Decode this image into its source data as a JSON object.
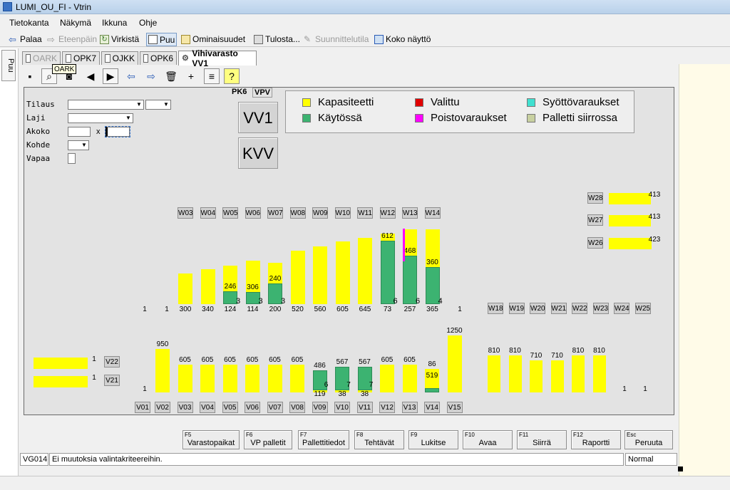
{
  "window": {
    "title": "LUMI_OU_FI - Vtrin"
  },
  "menu": [
    "Tietokanta",
    "Näkymä",
    "Ikkuna",
    "Ohje"
  ],
  "toolbar": {
    "back": "Palaa",
    "forward": "Eteenpäin",
    "refresh": "Virkistä",
    "tree": "Puu",
    "properties": "Ominaisuudet",
    "print": "Tulosta...",
    "design": "Suunnittelutila",
    "fullscreen": "Koko näyttö"
  },
  "side_tab": "Puu",
  "tabs": [
    "OARK",
    "OPK7",
    "OJKK",
    "OPK6",
    "Vihivarasto VV1"
  ],
  "tooltip": "OARK",
  "form": {
    "labels": [
      "Tilaus",
      "Laji",
      "Akoko",
      "Kohde",
      "Vapaa"
    ],
    "x_sep": "x",
    "pk_label": "PK6",
    "vpv_label": "VPV",
    "btn_vv1": "VV1",
    "btn_kvv": "KVV"
  },
  "legend": [
    {
      "label": "Kapasiteetti",
      "color": "#ffff00"
    },
    {
      "label": "Valittu",
      "color": "#e00000"
    },
    {
      "label": "Syöttövaraukset",
      "color": "#40e0d0"
    },
    {
      "label": "Käytössä",
      "color": "#3cb371"
    },
    {
      "label": "Poistovaraukset",
      "color": "#ff00ff"
    },
    {
      "label": "Palletti siirrossa",
      "color": "#c8d0a0"
    }
  ],
  "chart_data": {
    "type": "bar",
    "upper_row": {
      "lanes": [
        "W03",
        "W04",
        "W05",
        "W06",
        "W07",
        "W08",
        "W09",
        "W10",
        "W11",
        "W12",
        "W13",
        "W14"
      ],
      "capacity": [
        300,
        340,
        370,
        420,
        400,
        520,
        560,
        605,
        645,
        685,
        725,
        725
      ],
      "used": [
        0,
        0,
        124,
        114,
        200,
        0,
        0,
        0,
        0,
        612,
        468,
        360
      ],
      "used_label": [
        "",
        "",
        "246",
        "306",
        "240",
        "",
        "",
        "",
        "",
        "612",
        "468",
        "360"
      ],
      "count": [
        "",
        "",
        "3",
        "3",
        "3",
        "",
        "",
        "",
        "",
        "6",
        "6",
        "4"
      ],
      "bottom_values": [
        "300",
        "340",
        "124",
        "114",
        "200",
        "520",
        "560",
        "605",
        "645",
        "73",
        "257",
        "365"
      ],
      "edge_values": [
        "1",
        "1",
        "1"
      ]
    },
    "right_lanes": [
      {
        "name": "W28",
        "value": "413"
      },
      {
        "name": "W27",
        "value": "413"
      },
      {
        "name": "W26",
        "value": "423"
      }
    ],
    "mid_lanes": [
      "W18",
      "W19",
      "W20",
      "W21",
      "W22",
      "W23",
      "W24",
      "W25"
    ],
    "lower_row": {
      "lanes": [
        "V01",
        "V02",
        "V03",
        "V04",
        "V05",
        "V06",
        "V07",
        "V08",
        "V09",
        "V10",
        "V11",
        "V12",
        "V13",
        "V14",
        "V15"
      ],
      "capacity": [
        0,
        950,
        605,
        605,
        605,
        605,
        605,
        605,
        486,
        567,
        567,
        605,
        605,
        519,
        1250
      ],
      "used": [
        0,
        0,
        0,
        0,
        0,
        0,
        0,
        0,
        486,
        567,
        567,
        0,
        0,
        86,
        0
      ],
      "top_label": [
        "1",
        "950",
        "605",
        "605",
        "605",
        "605",
        "605",
        "605",
        "486",
        "567",
        "567",
        "605",
        "605",
        "86",
        "1250"
      ],
      "bottom_label": [
        "",
        "",
        "",
        "",
        "",
        "",
        "",
        "",
        "119",
        "38",
        "38",
        "",
        "",
        "519",
        ""
      ],
      "count": [
        "",
        "",
        "",
        "",
        "",
        "",
        "",
        "",
        "6",
        "7",
        "7",
        "",
        "",
        "",
        ""
      ]
    },
    "extra_lower": {
      "capacity": [
        810,
        810,
        710,
        710,
        810,
        810
      ],
      "labels": [
        "810",
        "810",
        "710",
        "710",
        "810",
        "810"
      ],
      "tail": [
        "1",
        "1"
      ]
    },
    "left_lanes": [
      {
        "name": "V22",
        "value": "1"
      },
      {
        "name": "V21",
        "value": "1"
      }
    ]
  },
  "fkeys": [
    {
      "key": "F5",
      "label": "Varastopaikat"
    },
    {
      "key": "F6",
      "label": "VP palletit"
    },
    {
      "key": "F7",
      "label": "Pallettitiedot"
    },
    {
      "key": "F8",
      "label": "Tehtävät"
    },
    {
      "key": "F9",
      "label": "Lukitse"
    },
    {
      "key": "F10",
      "label": "Avaa"
    },
    {
      "key": "F11",
      "label": "Siirrä"
    },
    {
      "key": "F12",
      "label": "Raportti"
    },
    {
      "key": "Esc",
      "label": "Peruuta"
    }
  ],
  "status": {
    "code": "VG014",
    "message": "Ei muutoksia valintakriteereihin.",
    "mode": "Normal"
  }
}
